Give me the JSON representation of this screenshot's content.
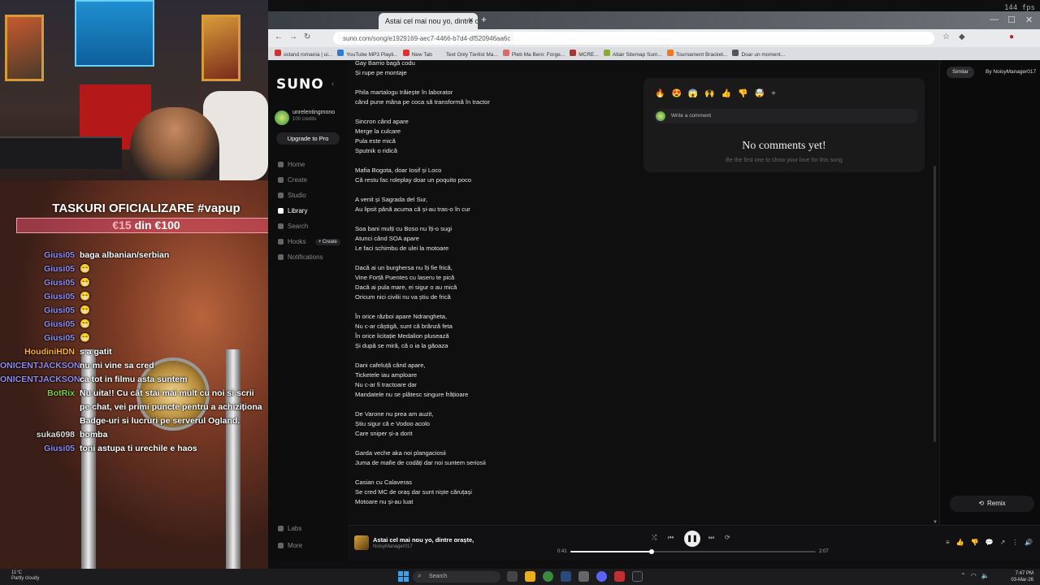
{
  "stream": {
    "banner_title": "TASKURI OFICIALIZARE #vapup",
    "banner_current": "€15",
    "banner_rest": " din €100",
    "chat": [
      {
        "user": "Giusi05",
        "color": "#8c8cf0",
        "text": "baga albanian/serbian"
      },
      {
        "user": "Giusi05",
        "color": "#8c8cf0",
        "text": "😁"
      },
      {
        "user": "Giusi05",
        "color": "#8c8cf0",
        "text": "😁"
      },
      {
        "user": "Giusi05",
        "color": "#8c8cf0",
        "text": "😁"
      },
      {
        "user": "Giusi05",
        "color": "#8c8cf0",
        "text": "😁"
      },
      {
        "user": "Giusi05",
        "color": "#8c8cf0",
        "text": "😁"
      },
      {
        "user": "Giusi05",
        "color": "#8c8cf0",
        "text": "😁"
      },
      {
        "user": "HoudiniHDN",
        "color": "#ffb020",
        "text": "s a gatit"
      },
      {
        "user": "ONICENTJACKSON",
        "color": "#8c8cf0",
        "text": "nu mi vine sa cred"
      },
      {
        "user": "ONICENTJACKSON",
        "color": "#8c8cf0",
        "text": "ca tot in filmu asta suntem"
      },
      {
        "user": "BotRix",
        "color": "#7cd040",
        "text": "Nu uita!! Cu cât stai mai mult cu noi si scrii pe chat, vei primi puncte pentru a achiziționa Badge-uri si lucruri pe serverul Ogland."
      },
      {
        "user": "suka6098",
        "color": "#dddddd",
        "text": "bomba"
      },
      {
        "user": "Giusi05",
        "color": "#8c8cf0",
        "text": "toni astupa ti urechile e haos"
      }
    ]
  },
  "browser": {
    "tab_title": "Astai cel mai nou yo, dintre oraș...",
    "url": "suno.com/song/e1929169-aec7-4466-b7d4-df520946aa6c",
    "bookmarks": [
      "ocland romania | ui...",
      "YouTube MP3 Playli...",
      "New Tab",
      "Text Only Tierlist Ma...",
      "Pleb Ma Bero: Forge...",
      "MCRE...",
      "Altair Sitemap Sum...",
      "Tournament Bracket...",
      "Doar un moment..."
    ],
    "fps": "144 fps"
  },
  "sidebar": {
    "logo": "SUNO",
    "username": "unrelentingmono",
    "credits": "100 credits",
    "upgrade": "Upgrade to Pro",
    "items": [
      {
        "label": "Home"
      },
      {
        "label": "Create"
      },
      {
        "label": "Studio"
      },
      {
        "label": "Library"
      },
      {
        "label": "Search"
      },
      {
        "label": "Hooks"
      },
      {
        "label": "Notifications"
      }
    ],
    "hooks_create": "+ Create",
    "labs": "Labs",
    "more": "More"
  },
  "lyrics": [
    [
      "Gay Barrio bagă codu",
      "Și rupe pe montaje"
    ],
    [
      "Phila martalogu trăiește în laborator",
      "când pune mâna pe coca să transformă în tractor"
    ],
    [
      "Sincron când apare",
      "Merge la culcare",
      "Pula este mică",
      "Sputnik o ridică"
    ],
    [
      "Mafia Bogota, doar Iosif și Loco",
      "Că restu fac roleplay doar un poquito poco"
    ],
    [
      "A venit și Sagrada del Sur,",
      "Au lipsit până acuma că și-au tras-o în cur"
    ],
    [
      "Soa bani mulți cu Boso nu îți-o sugi",
      "Atunci când SOA apare",
      "Le faci schimbu de ulei la motoare"
    ],
    [
      "Dacă ai un burghersa nu îți fie frică,",
      "Vine Forță Puentes cu laseru te pică",
      "Dacă ai pula mare, ei sigur o au mică",
      "Oricum nici civilii nu va știu de frică"
    ],
    [
      "În orice război apare Ndrangheta,",
      "Nu c-ar câștigă, sunt că brânză feta",
      "În orice licitație Medalion plusează",
      "Și după se miră, că o ia la găoaza"
    ],
    [
      "Dani cafeluță când apare,",
      "Ticketele iau amploare",
      "Nu c-ar fi tractoare dar",
      "Mandatele nu se plătesc singure frățioare"
    ],
    [
      "De Varone nu prea am auzit,",
      "Știu sigur că e Vodoo acolo",
      "Care sniper și-a dorit"
    ],
    [
      "Garda veche aka noi plangaciosii",
      "Juma de mafie de codăți dar noi suntem seriosii"
    ],
    [
      "Casian cu Calaveras",
      "Se cred MC de oraș dar sunt niște căruțași",
      "Motoare nu și-au luat"
    ]
  ],
  "comments": {
    "reactions": [
      "🔥",
      "😍",
      "😱",
      "🙌",
      "👍",
      "👎",
      "🤯"
    ],
    "placeholder": "Write a comment",
    "empty_title": "No comments yet!",
    "empty_sub": "Be the first one to show your love for this song"
  },
  "right_panel": {
    "tab_similar": "Similar",
    "tab_by": "By NoisyManager017",
    "remix": "Remix"
  },
  "player": {
    "title": "Astai cel mai nou yo, dintre oraște,",
    "artist": "NoisyManager017",
    "elapsed": "0:41",
    "duration": "2:07",
    "progress": 0.33
  },
  "taskbar": {
    "weather_temp": "11°C",
    "weather_desc": "Partly cloudy",
    "search": "Search",
    "time": "7:47 PM",
    "date": "03-Mar-26"
  }
}
